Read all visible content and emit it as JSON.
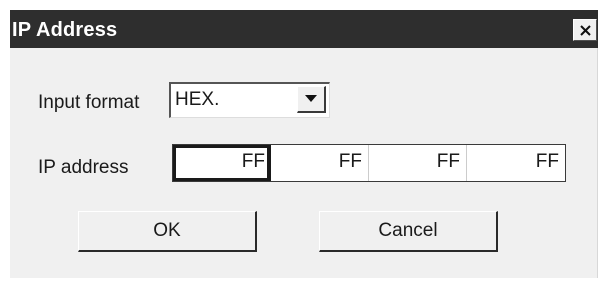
{
  "dialog": {
    "title": "IP Address",
    "close_icon": "close-icon",
    "close_glyph": "×"
  },
  "form": {
    "input_format_label": "Input format",
    "input_format_value": "HEX.",
    "dropdown_icon": "chevron-down-icon",
    "ip_label": "IP address",
    "ip_octets": [
      "FF",
      "FF",
      "FF",
      "FF"
    ]
  },
  "buttons": {
    "ok_label": "OK",
    "cancel_label": "Cancel"
  },
  "colors": {
    "titlebar_bg": "#2e2e2e",
    "dialog_bg": "#f0f0f0",
    "field_bg": "#ffffff"
  }
}
